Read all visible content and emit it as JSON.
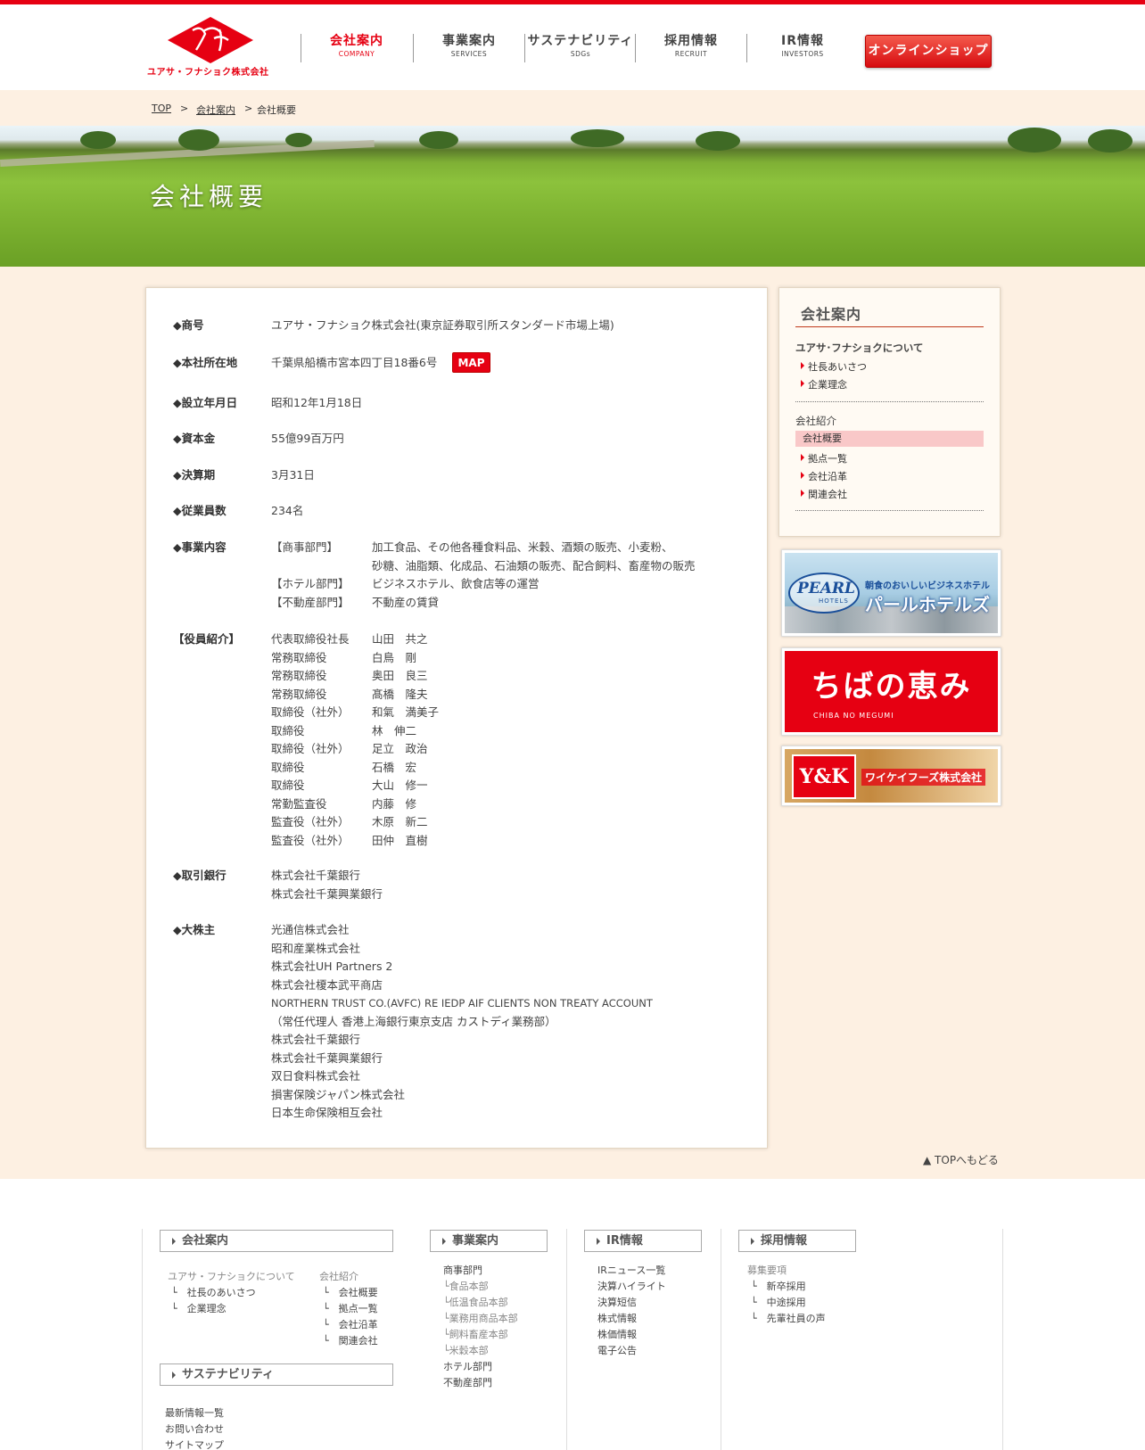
{
  "header": {
    "logo_text": "ユアサ・フナショク株式会社",
    "nav": [
      {
        "jp": "会社案内",
        "en": "COMPANY"
      },
      {
        "jp": "事業案内",
        "en": "SERVICES"
      },
      {
        "jp": "サステナビリティ",
        "en": "SDGs"
      },
      {
        "jp": "採用情報",
        "en": "RECRUIT"
      },
      {
        "jp": "IR情報",
        "en": "INVESTORS"
      }
    ],
    "shop_label": "オンラインショップ"
  },
  "breadcrumb": {
    "top": "TOP",
    "sep1": ">",
    "company": "会社案内",
    "sep2": ">",
    "current": "会社概要"
  },
  "hero": {
    "title": "会社概要"
  },
  "profile": {
    "trade_name": {
      "label": "◆商号",
      "value": "ユアサ・フナショク株式会社(東京証券取引所スタンダード市場上場)"
    },
    "head_office": {
      "label": "◆本社所在地",
      "value": "千葉県船橋市宮本四丁目18番6号",
      "map": "MAP"
    },
    "founded": {
      "label": "◆設立年月日",
      "value": "昭和12年1月18日"
    },
    "capital": {
      "label": "◆資本金",
      "value": "55億99百万円"
    },
    "fiscal": {
      "label": "◆決算期",
      "value": "3月31日"
    },
    "employees": {
      "label": "◆従業員数",
      "value": "234名"
    },
    "business": {
      "label": "◆事業内容",
      "items": [
        {
          "dept": "【商事部門】",
          "desc": "加工食品、その他各種食料品、米穀、酒類の販売、小麦粉、"
        },
        {
          "dept": "",
          "desc": "砂糖、油脂類、化成品、石油類の販売、配合飼料、畜産物の販売"
        },
        {
          "dept": "【ホテル部門】",
          "desc": "ビジネスホテル、飲食店等の運営"
        },
        {
          "dept": "【不動産部門】",
          "desc": "不動産の賃貸"
        }
      ]
    },
    "officers": {
      "label": "【役員紹介】",
      "items": [
        {
          "title": "代表取締役社長",
          "name": "山田　共之"
        },
        {
          "title": "常務取締役",
          "name": "白鳥　剛"
        },
        {
          "title": "常務取締役",
          "name": "奥田　良三"
        },
        {
          "title": "常務取締役",
          "name": "髙橋　隆夫"
        },
        {
          "title": "取締役（社外）",
          "name": "和氣　満美子"
        },
        {
          "title": "取締役",
          "name": "林　伸二"
        },
        {
          "title": "取締役（社外）",
          "name": "足立　政治"
        },
        {
          "title": "取締役",
          "name": "石橋　宏"
        },
        {
          "title": "取締役",
          "name": "大山　修一"
        },
        {
          "title": "常勤監査役",
          "name": "内藤　修"
        },
        {
          "title": "監査役（社外）",
          "name": "木原　新二"
        },
        {
          "title": "監査役（社外）",
          "name": "田仲　直樹"
        }
      ]
    },
    "banks": {
      "label": "◆取引銀行",
      "items": [
        "株式会社千葉銀行",
        "株式会社千葉興業銀行"
      ]
    },
    "shareholders": {
      "label": "◆大株主",
      "items": [
        "光通信株式会社",
        "昭和産業株式会社",
        "株式会社UH Partners 2",
        "株式会社榎本武平商店",
        "NORTHERN TRUST CO.(AVFC) RE IEDP AIF CLIENTS NON TREATY ACCOUNT",
        "（常任代理人 香港上海銀行東京支店 カストディ業務部）",
        "株式会社千葉銀行",
        "株式会社千葉興業銀行",
        "双日食料株式会社",
        "損害保険ジャパン株式会社",
        "日本生命保険相互会社"
      ]
    }
  },
  "sidebar": {
    "title": "会社案内",
    "about_head": "ユアサ･フナショクについて",
    "about_links": [
      "社長あいさつ",
      "企業理念"
    ],
    "intro_head": "会社紹介",
    "intro_links": [
      "会社概要",
      "拠点一覧",
      "会社沿革",
      "関連会社"
    ]
  },
  "banners": {
    "pearl_logo": "PEARL",
    "pearl_sub": "HOTELS",
    "pearl_tagline": "朝食のおいしいビジネスホテル",
    "pearl_name": "パールホテルズ",
    "chiba_name": "ちばの恵み",
    "chiba_roman": "CHIBA NO MEGUMI",
    "yk_logo": "Y&K",
    "yk_name": "ワイケイフーズ株式会社"
  },
  "pagetop": "TOPへもどる",
  "footer": {
    "company": {
      "head": "会社案内",
      "about": "ユアサ・フナショクについて",
      "about_links": [
        "社長のあいさつ",
        "企業理念"
      ],
      "intro": "会社紹介",
      "intro_links": [
        "会社概要",
        "拠点一覧",
        "会社沿革",
        "関連会社"
      ]
    },
    "sustain": {
      "head": "サステナビリティ"
    },
    "misc": [
      "最新情報一覧",
      "お問い合わせ",
      "サイトマップ"
    ],
    "services": {
      "head": "事業案内",
      "links": [
        "商事部門",
        "└食品本部",
        "└低温食品本部",
        "└業務用商品本部",
        "└飼料畜産本部",
        "└米穀本部",
        "ホテル部門",
        "不動産部門"
      ]
    },
    "ir": {
      "head": "IR情報",
      "links": [
        "IRニュース一覧",
        "決算ハイライト",
        "決算短信",
        "株式情報",
        "株価情報",
        "電子公告"
      ]
    },
    "recruit": {
      "head": "採用情報",
      "links": [
        "募集要項",
        "新卒採用",
        "中途採用",
        "先輩社員の声"
      ]
    }
  },
  "colors": {
    "brand_red": "#e60012",
    "bg_cream": "#fdf0e2"
  }
}
